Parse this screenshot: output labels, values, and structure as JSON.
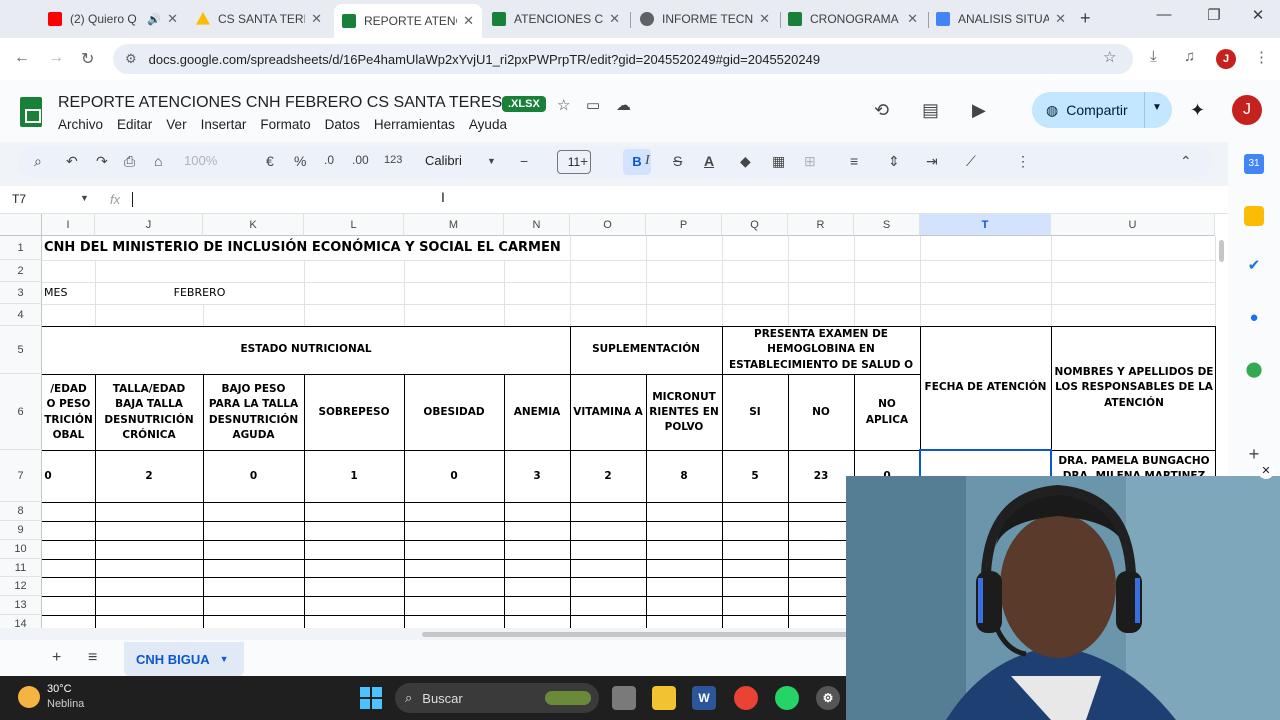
{
  "browser": {
    "tabs": [
      {
        "label": "(2) Quiero Q",
        "icon": "youtube-icon",
        "color": "#ff0000"
      },
      {
        "label": "CS SANTA TERES",
        "icon": "drive-icon",
        "color": "#fbbc04"
      },
      {
        "label": "REPORTE ATENC",
        "icon": "sheets-icon",
        "color": "#188038",
        "active": true
      },
      {
        "label": "ATENCIONES CN",
        "icon": "sheets-icon",
        "color": "#188038"
      },
      {
        "label": "INFORME TECN",
        "icon": "globe-icon",
        "color": "#5f6368"
      },
      {
        "label": "CRONOGRAMA",
        "icon": "sheets-icon",
        "color": "#188038"
      },
      {
        "label": "ANALISIS SITUA",
        "icon": "docs-icon",
        "color": "#4285f4"
      }
    ],
    "new_tab": "+",
    "url": "docs.google.com/spreadsheets/d/16Pe4hamUlaWp2xYvjU1_ri2pxPWPrpTR/edit?gid=2045520249#gid=2045520249",
    "profile_initial": "J"
  },
  "doc": {
    "title": "REPORTE ATENCIONES CNH FEBRERO CS SANTA TERESA",
    "badge": ".XLSX",
    "menu": [
      "Archivo",
      "Editar",
      "Ver",
      "Insertar",
      "Formato",
      "Datos",
      "Herramientas",
      "Ayuda"
    ],
    "share_label": "Compartir",
    "avatar_initial": "J"
  },
  "toolbar": {
    "zoom": "100%",
    "currency": "€",
    "percent": "%",
    "dec_decrease": ".0",
    "dec_increase": ".00",
    "number_format": "123",
    "font": "Calibri",
    "font_size": "11",
    "bold": "B",
    "italic": "I",
    "strike": "S",
    "text_color": "A"
  },
  "formula": {
    "cell_ref": "T7",
    "fx": "fx",
    "content": ""
  },
  "grid": {
    "columns": [
      "I",
      "J",
      "K",
      "L",
      "M",
      "N",
      "O",
      "P",
      "Q",
      "R",
      "S",
      "T",
      "U"
    ],
    "selected_column": "T",
    "rows": [
      "1",
      "2",
      "3",
      "4",
      "5",
      "6",
      "7",
      "8",
      "9",
      "10",
      "11",
      "12",
      "13",
      "14"
    ],
    "title": "CNH DEL MINISTERIO DE INCLUSIÓN ECONÓMICA Y SOCIAL EL CARMEN",
    "mes_label": "MES",
    "mes_value": "FEBRERO",
    "group_headers": {
      "estado": "ESTADO NUTRICIONAL",
      "suplementacion": "SUPLEMENTACIÓN",
      "hemoglobina": "PRESENTA EXAMEN DE HEMOGLOBINA EN ESTABLECIMIENTO DE SALUD O",
      "fecha": "FECHA DE ATENCIÓN",
      "nombres": "NOMBRES Y APELLIDOS DE LOS RESPONSABLES DE LA ATENCIÓN"
    },
    "sub_headers": [
      "/EDAD\nO PESO\nTRICIÓN\nOBAL",
      "TALLA/EDAD BAJA TALLA DESNUTRICIÓN CRÓNICA",
      "BAJO PESO PARA LA TALLA DESNUTRICIÓN AGUDA",
      "SOBREPESO",
      "OBESIDAD",
      "ANEMIA",
      "VITAMINA A",
      "MICRONUT RIENTES EN POLVO",
      "SI",
      "NO",
      "NO APLICA"
    ],
    "values": [
      "0",
      "2",
      "0",
      "1",
      "0",
      "3",
      "2",
      "8",
      "5",
      "23",
      "0"
    ],
    "responsables": "DRA. PAMELA BUNGACHO\nDRA. MILENA MARTINEZ"
  },
  "sheets": {
    "add": "+",
    "list": "≡",
    "active_tab": "CNH BIGUA"
  },
  "taskbar": {
    "temperature": "30°C",
    "condition": "Neblina",
    "search_placeholder": "Buscar"
  }
}
